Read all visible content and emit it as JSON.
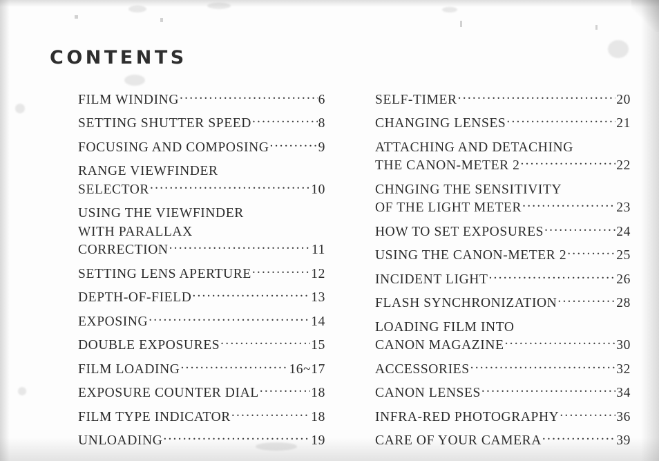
{
  "page": {
    "title": "CONTENTS",
    "ink_color": "#2b2b2b",
    "paper_color": "#fdfdfd"
  },
  "contents": {
    "left_column": [
      {
        "lines": [
          "FILM WINDING"
        ],
        "page": "6"
      },
      {
        "lines": [
          "SETTING SHUTTER SPEED"
        ],
        "page": "8"
      },
      {
        "lines": [
          "FOCUSING AND COMPOSING"
        ],
        "page": "9"
      },
      {
        "lines": [
          "RANGE VIEWFINDER",
          "SELECTOR"
        ],
        "page": "10"
      },
      {
        "lines": [
          "USING THE VIEWFINDER",
          "WITH PARALLAX",
          "CORRECTION"
        ],
        "page": "11"
      },
      {
        "lines": [
          "SETTING LENS APERTURE"
        ],
        "page": "12"
      },
      {
        "lines": [
          "DEPTH-OF-FIELD"
        ],
        "page": "13"
      },
      {
        "lines": [
          "EXPOSING"
        ],
        "page": "14"
      },
      {
        "lines": [
          "DOUBLE EXPOSURES"
        ],
        "page": "15"
      },
      {
        "lines": [
          "FILM LOADING"
        ],
        "page": "16~17"
      },
      {
        "lines": [
          "EXPOSURE COUNTER DIAL"
        ],
        "page": "18"
      },
      {
        "lines": [
          "FILM TYPE INDICATOR"
        ],
        "page": "18"
      },
      {
        "lines": [
          "UNLOADING"
        ],
        "page": "19"
      }
    ],
    "right_column": [
      {
        "lines": [
          "SELF-TIMER"
        ],
        "page": "20"
      },
      {
        "lines": [
          "CHANGING LENSES"
        ],
        "page": "21"
      },
      {
        "lines": [
          "ATTACHING AND DETACHING",
          "THE CANON-METER 2"
        ],
        "page": "22"
      },
      {
        "lines": [
          "CHNGING THE SENSITIVITY",
          "OF THE LIGHT METER"
        ],
        "page": "23"
      },
      {
        "lines": [
          "HOW TO SET EXPOSURES"
        ],
        "page": "24"
      },
      {
        "lines": [
          "USING THE CANON-METER 2"
        ],
        "page": "25"
      },
      {
        "lines": [
          "INCIDENT LIGHT"
        ],
        "page": "26"
      },
      {
        "lines": [
          "FLASH SYNCHRONIZATION"
        ],
        "page": "28"
      },
      {
        "lines": [
          "LOADING FILM INTO",
          "CANON MAGAZINE"
        ],
        "page": "30"
      },
      {
        "lines": [
          "ACCESSORIES"
        ],
        "page": "32"
      },
      {
        "lines": [
          "CANON LENSES"
        ],
        "page": "34"
      },
      {
        "lines": [
          "INFRA-RED PHOTOGRAPHY"
        ],
        "page": "36"
      },
      {
        "lines": [
          "CARE OF YOUR CAMERA"
        ],
        "page": "39"
      }
    ]
  }
}
